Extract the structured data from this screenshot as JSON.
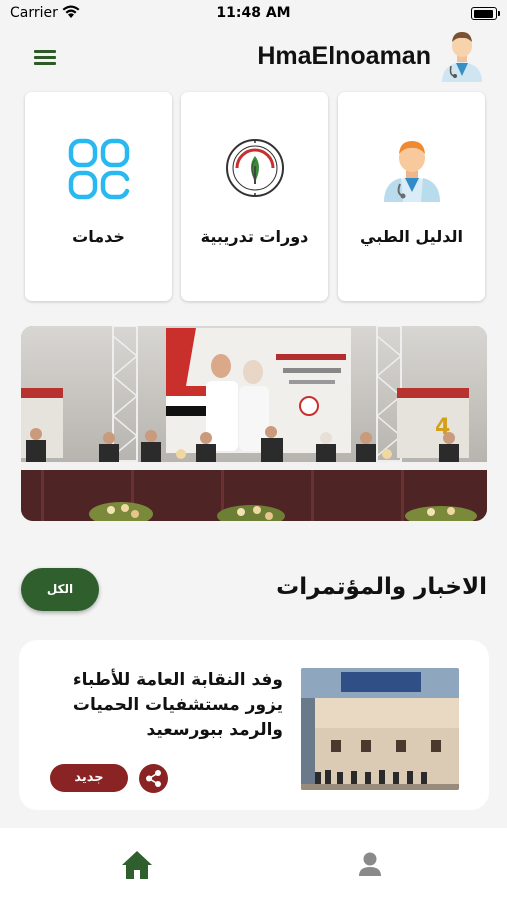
{
  "status": {
    "carrier": "Carrier",
    "time": "11:48 AM"
  },
  "header": {
    "title": "HmaElnoaman"
  },
  "icons": {
    "menu": "menu-icon",
    "doctor": "doctor-icon",
    "services": "grid-icon",
    "courses": "syndicate-logo",
    "home": "home-icon",
    "profile": "person-icon",
    "share": "share-icon",
    "wifi": "wifi-icon"
  },
  "tiles": [
    {
      "label": "الدليل الطبي"
    },
    {
      "label": "دورات تدريبية"
    },
    {
      "label": "خدمات"
    }
  ],
  "news_section": {
    "title": "الاخبار والمؤتمرات",
    "all_label": "الكل"
  },
  "news_items": [
    {
      "headline": "وفد النقابة العامة للأطباء يزور مستشفيات الحميات والرمد ببورسعيد",
      "badge": "جديد"
    }
  ],
  "colors": {
    "primary_green": "#2f5f2c",
    "badge_red": "#8a2323",
    "background": "#f4f4f4",
    "services_cyan": "#29b9f0"
  }
}
